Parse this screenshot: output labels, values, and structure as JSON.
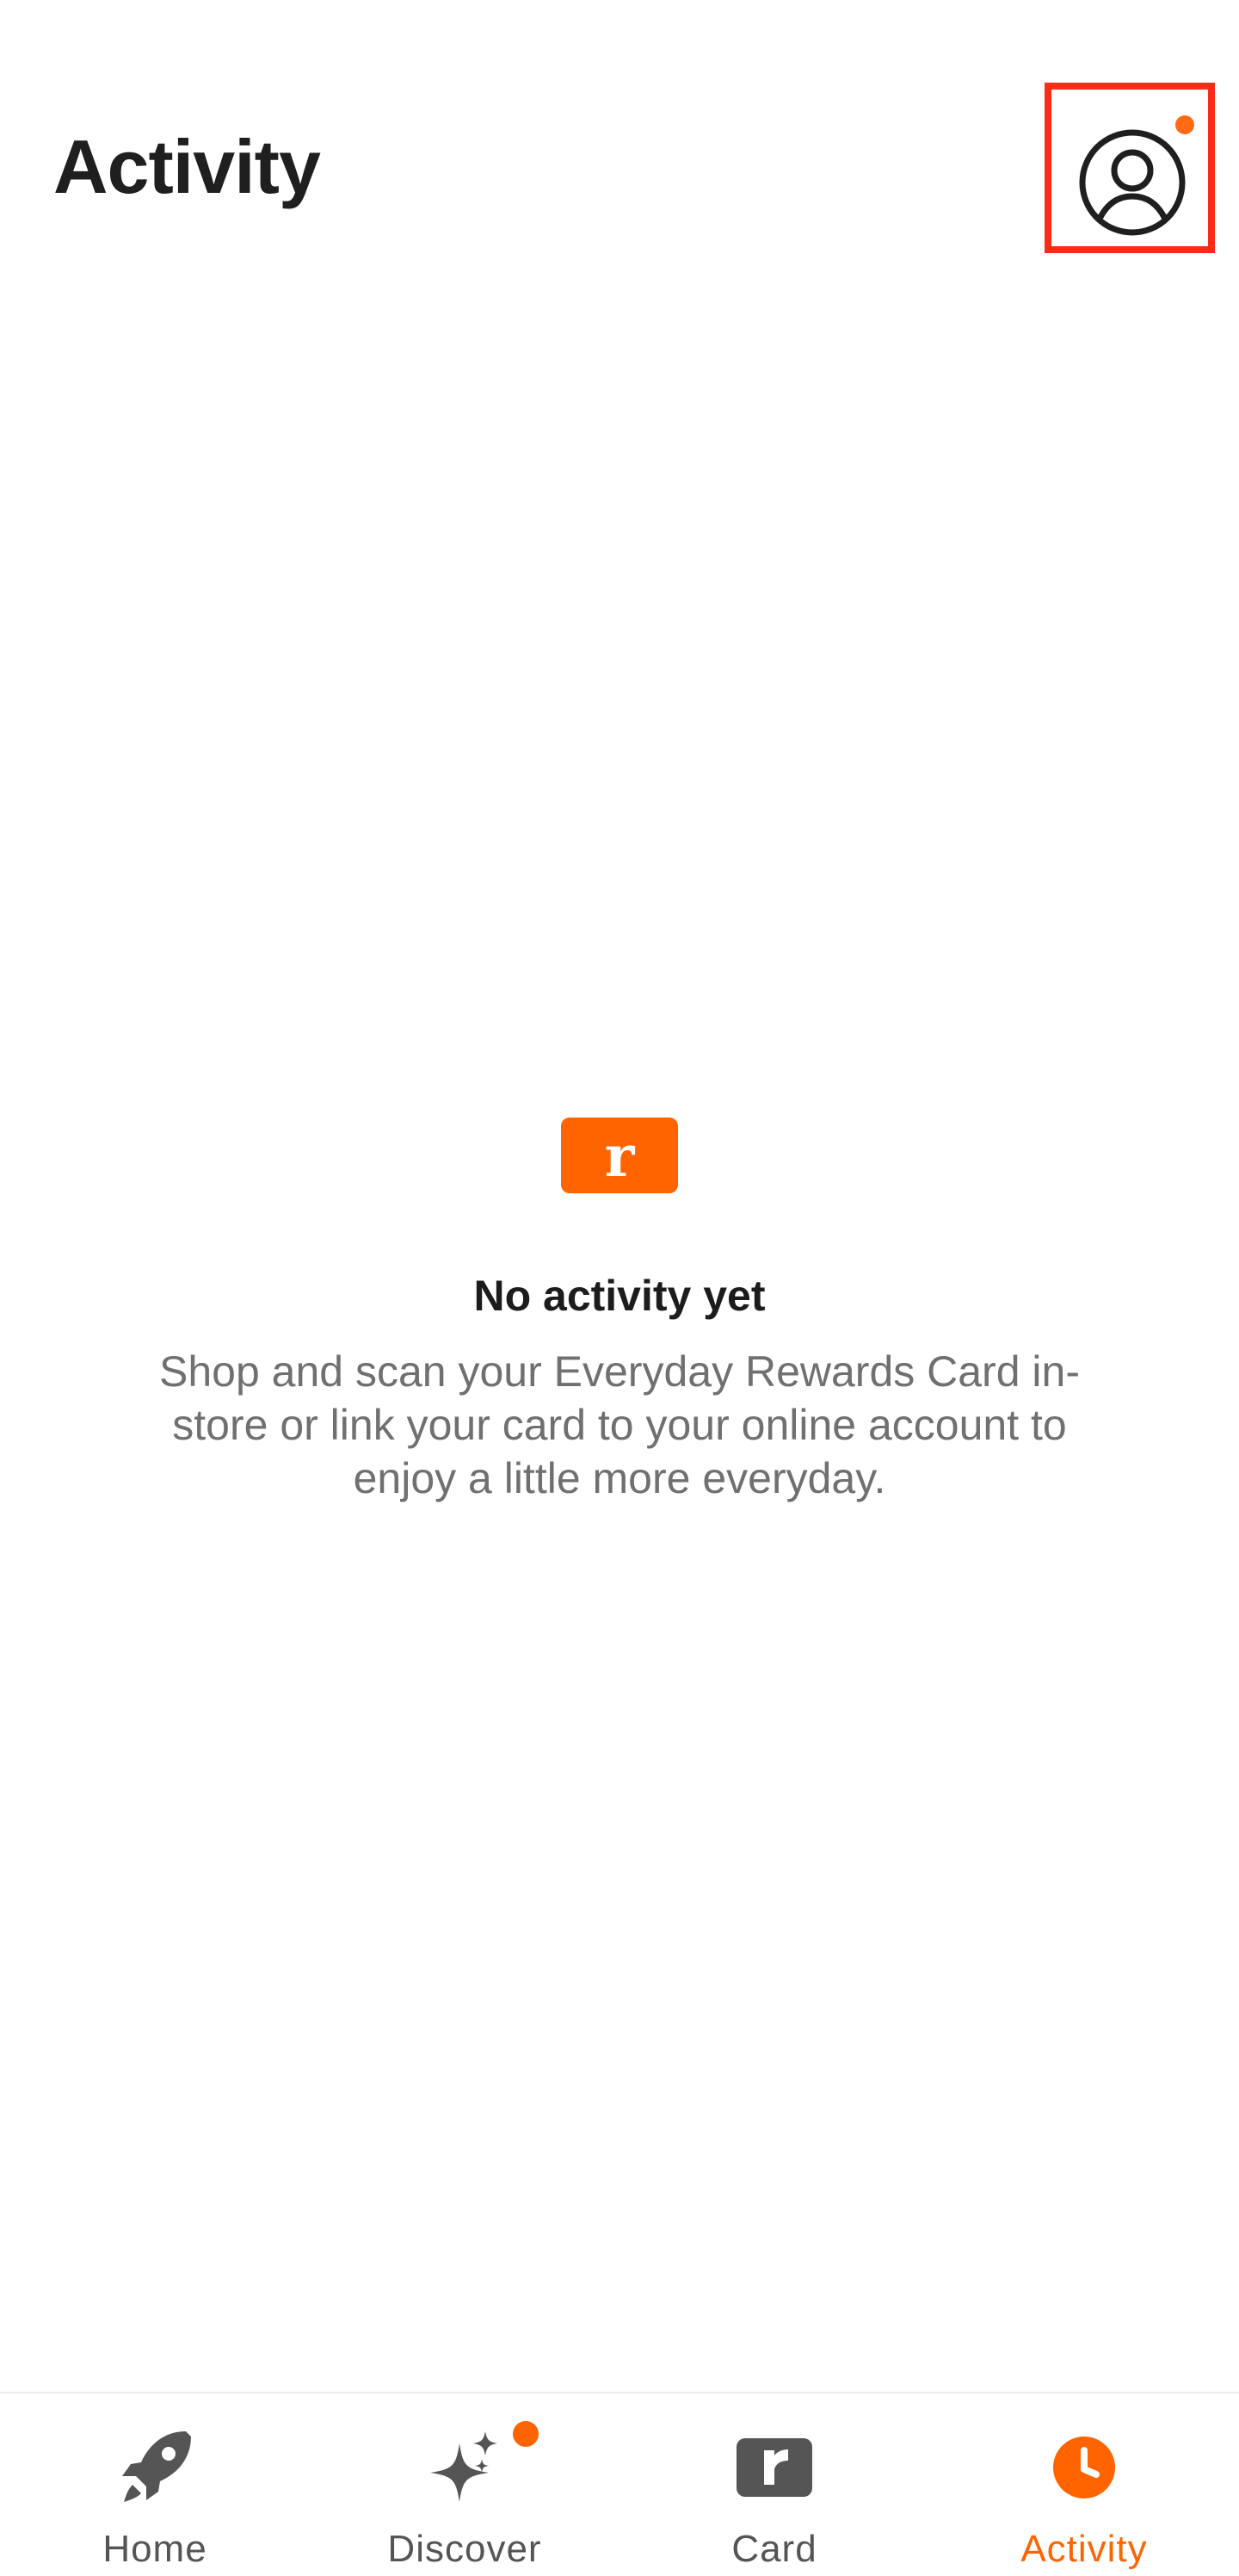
{
  "header": {
    "title": "Activity",
    "profile_icon": "account-circle-icon",
    "profile_has_notification": true
  },
  "empty_state": {
    "logo_letter": "r",
    "title": "No activity yet",
    "description": "Shop and scan your Everyday Rewards Card in-store or link your card to your online account to enjoy a little more everyday."
  },
  "bottom_nav": {
    "items": [
      {
        "label": "Home",
        "icon": "rocket-icon",
        "active": false,
        "badge": false
      },
      {
        "label": "Discover",
        "icon": "sparkle-icon",
        "active": false,
        "badge": true
      },
      {
        "label": "Card",
        "icon": "rewards-card-icon",
        "active": false,
        "badge": false
      },
      {
        "label": "Activity",
        "icon": "clock-icon",
        "active": true,
        "badge": false
      }
    ]
  },
  "colors": {
    "accent": "#ff6400",
    "highlight_box": "#ff2a16",
    "text_primary": "#1f1f1f",
    "text_secondary": "#707070",
    "nav_inactive": "#555555"
  }
}
